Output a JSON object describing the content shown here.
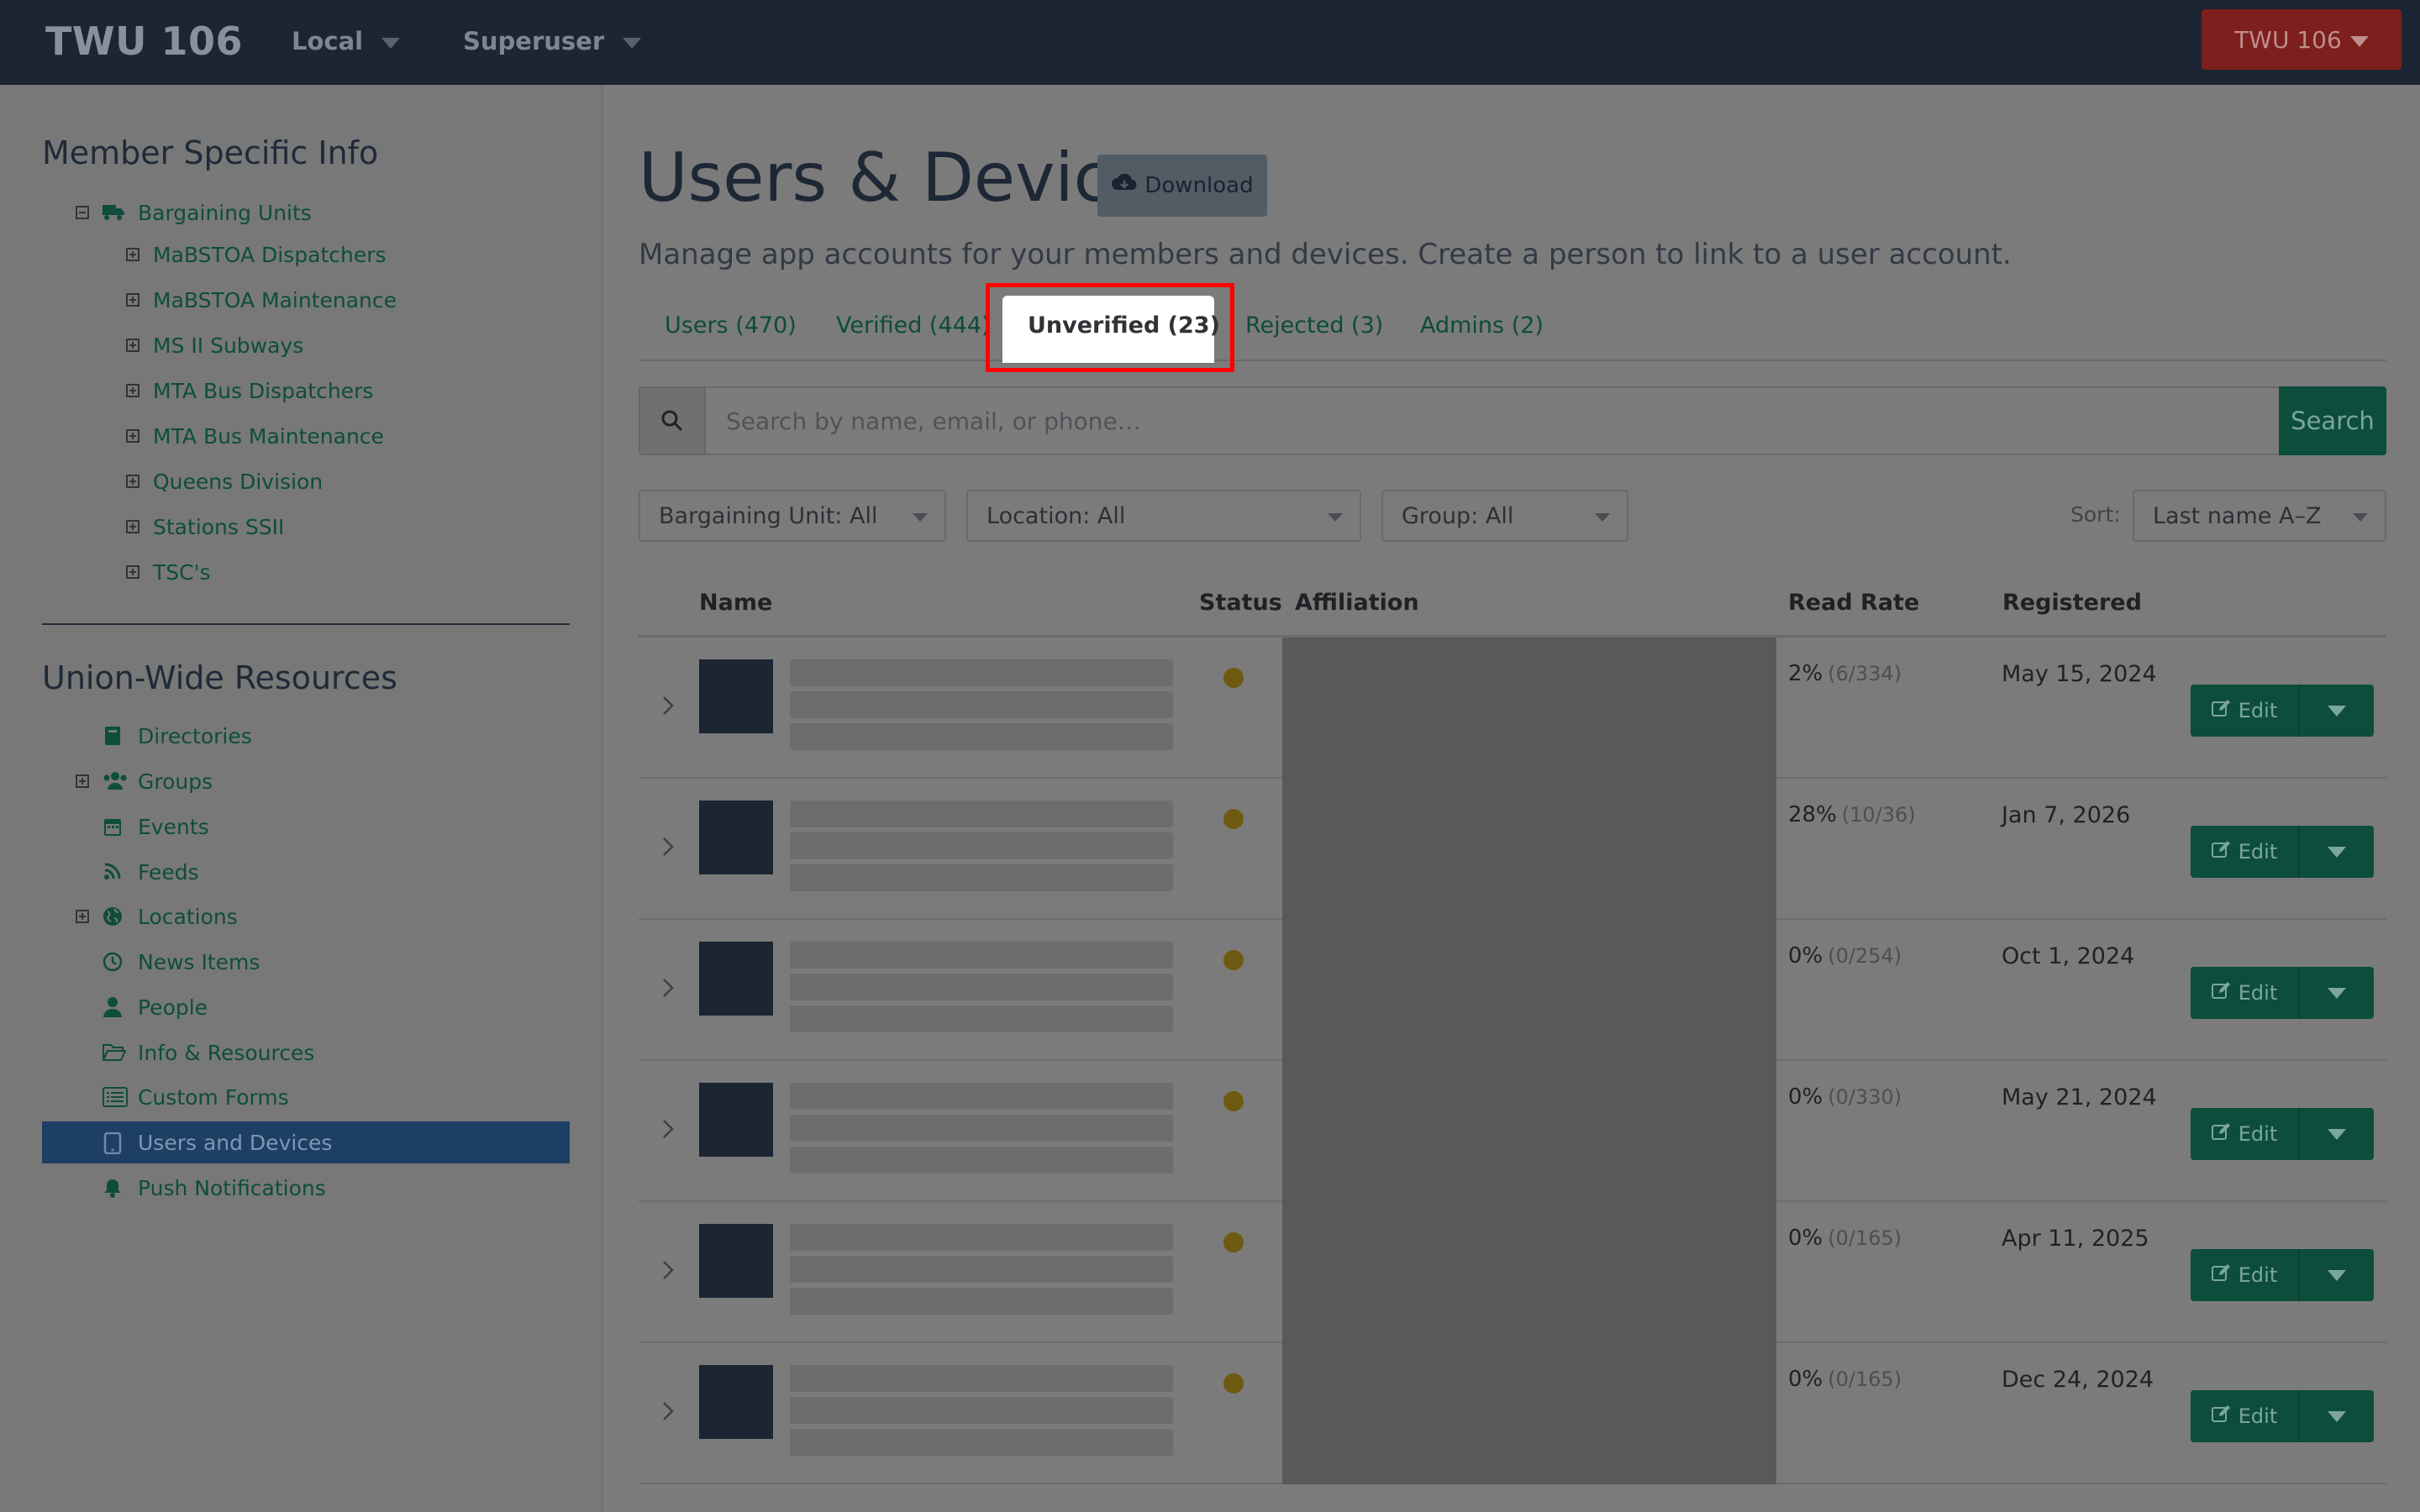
{
  "topbar": {
    "brand": "TWU 106",
    "nav": [
      {
        "label": "Local"
      },
      {
        "label": "Superuser"
      }
    ],
    "org_button": "TWU 106"
  },
  "sidebar": {
    "section1_title": "Member Specific Info",
    "bargaining_units_label": "Bargaining Units",
    "units": [
      "MaBSTOA Dispatchers",
      "MaBSTOA Maintenance",
      "MS II Subways",
      "MTA Bus Dispatchers",
      "MTA Bus Maintenance",
      "Queens Division",
      "Stations SSII",
      "TSC's"
    ],
    "section2_title": "Union-Wide Resources",
    "resources": [
      {
        "label": "Directories",
        "icon": "book-icon",
        "expandable": false
      },
      {
        "label": "Groups",
        "icon": "users-icon",
        "expandable": true
      },
      {
        "label": "Events",
        "icon": "calendar-icon",
        "expandable": false
      },
      {
        "label": "Feeds",
        "icon": "rss-icon",
        "expandable": false
      },
      {
        "label": "Locations",
        "icon": "globe-icon",
        "expandable": true
      },
      {
        "label": "News Items",
        "icon": "clock-icon",
        "expandable": false
      },
      {
        "label": "People",
        "icon": "person-icon",
        "expandable": false
      },
      {
        "label": "Info & Resources",
        "icon": "folder-open-icon",
        "expandable": false
      },
      {
        "label": "Custom Forms",
        "icon": "list-icon",
        "expandable": false
      },
      {
        "label": "Users and Devices",
        "icon": "tablet-icon",
        "expandable": false,
        "active": true
      },
      {
        "label": "Push Notifications",
        "icon": "bell-icon",
        "expandable": false
      }
    ]
  },
  "page": {
    "title": "Users & Devices",
    "download_label": "Download",
    "subtitle": "Manage app accounts for your members and devices. Create a person to link to a user account."
  },
  "tabs": [
    {
      "label": "Users (470)"
    },
    {
      "label": "Verified (444)"
    },
    {
      "label": "Unverified (23)",
      "active": true
    },
    {
      "label": "Rejected (3)"
    },
    {
      "label": "Admins (2)"
    }
  ],
  "search": {
    "placeholder": "Search by name, email, or phone…",
    "value": "",
    "button_label": "Search"
  },
  "filters": {
    "bargaining_unit": "Bargaining Unit: All",
    "location": "Location: All",
    "group": "Group: All",
    "sort_label": "Sort:",
    "sort_value": "Last name A–Z"
  },
  "table": {
    "headers": {
      "name": "Name",
      "status": "Status",
      "affiliation": "Affiliation",
      "read_rate": "Read Rate",
      "registered": "Registered"
    },
    "edit_label": "Edit",
    "rows": [
      {
        "rate": "2%",
        "rate_detail": "(6/334)",
        "registered": "May 15, 2024"
      },
      {
        "rate": "28%",
        "rate_detail": "(10/36)",
        "registered": "Jan 7, 2026"
      },
      {
        "rate": "0%",
        "rate_detail": "(0/254)",
        "registered": "Oct 1, 2024"
      },
      {
        "rate": "0%",
        "rate_detail": "(0/330)",
        "registered": "May 21, 2024"
      },
      {
        "rate": "0%",
        "rate_detail": "(0/165)",
        "registered": "Apr 11, 2025"
      },
      {
        "rate": "0%",
        "rate_detail": "(0/165)",
        "registered": "Dec 24, 2024"
      }
    ]
  },
  "colors": {
    "topbar": "#1b2533",
    "accent_green": "#0d4d3c",
    "org_red": "#7d1f1c",
    "status_unverified": "#6e5a10",
    "highlight": "#ff0000"
  }
}
